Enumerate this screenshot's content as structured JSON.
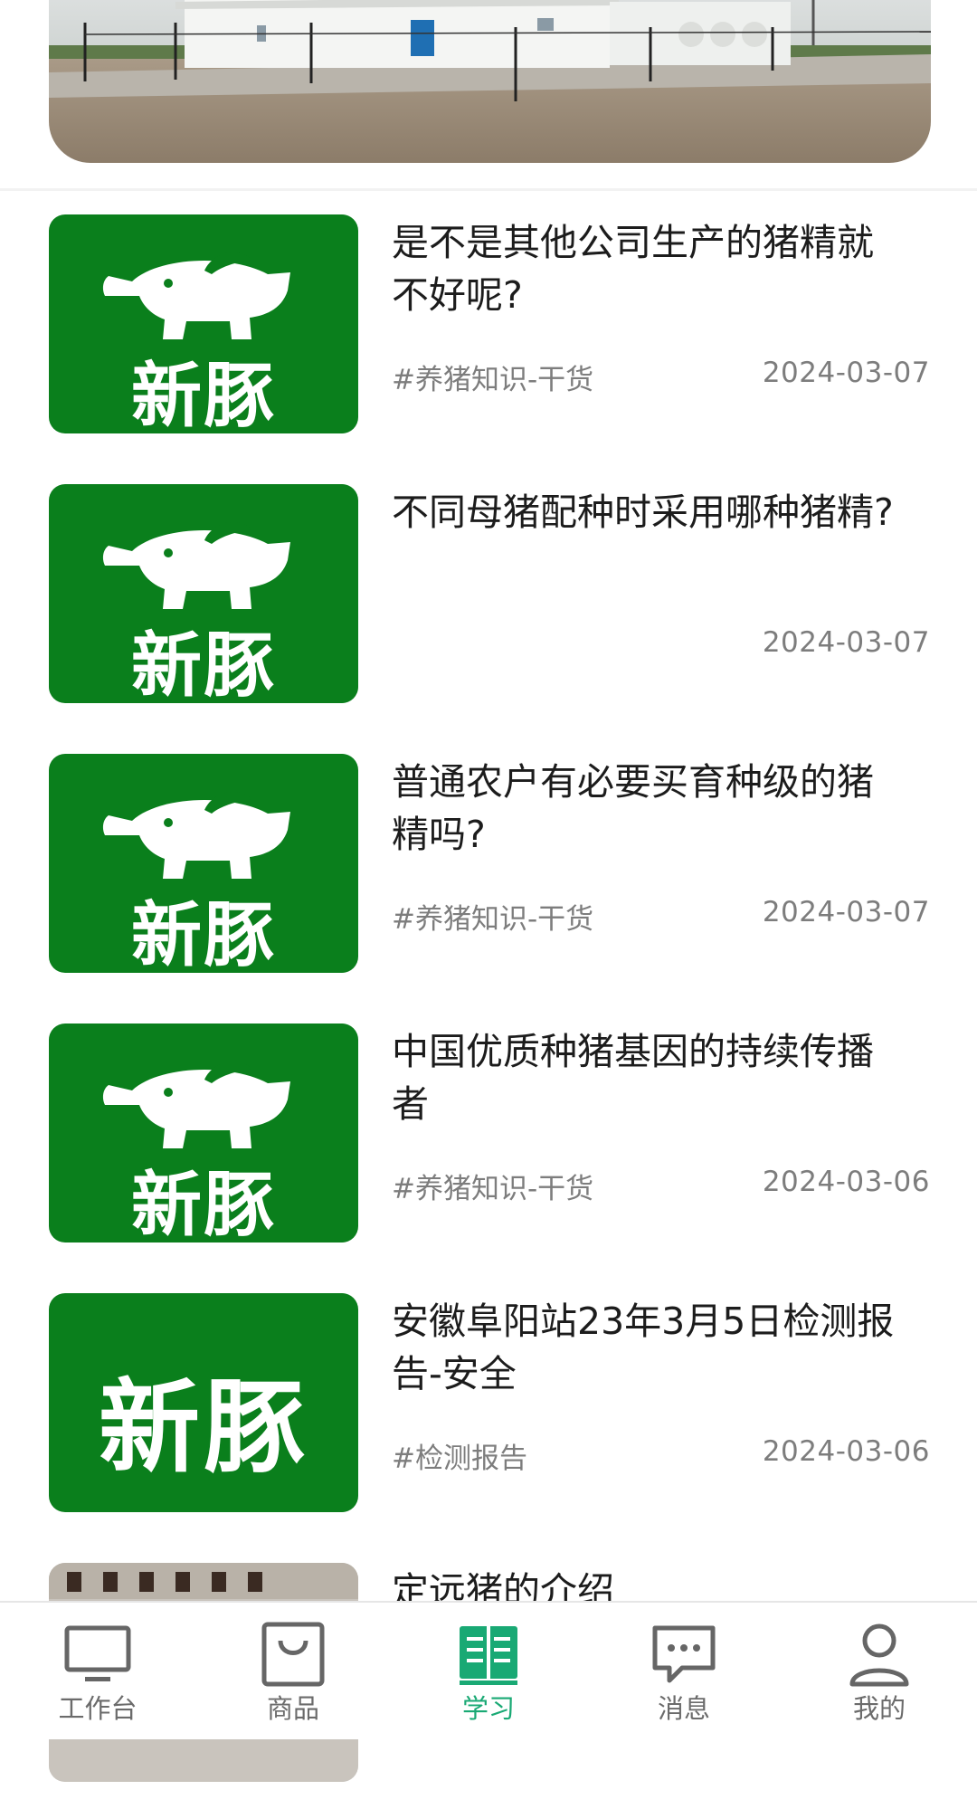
{
  "articles": [
    {
      "title": "是不是其他公司生产的猪精就不好呢?",
      "tag": "#养猪知识-干货",
      "date": "2024-03-07",
      "thumb": "logo-pig"
    },
    {
      "title": "不同母猪配种时采用哪种猪精?",
      "tag": "",
      "date": "2024-03-07",
      "thumb": "logo-pig"
    },
    {
      "title": "普通农户有必要买育种级的猪精吗?",
      "tag": "#养猪知识-干货",
      "date": "2024-03-07",
      "thumb": "logo-pig"
    },
    {
      "title": "中国优质种猪基因的持续传播者",
      "tag": "#养猪知识-干货",
      "date": "2024-03-06",
      "thumb": "logo-pig"
    },
    {
      "title": "安徽阜阳站23年3月5日检测报告-安全",
      "tag": "#检测报告",
      "date": "2024-03-06",
      "thumb": "logo-text"
    },
    {
      "title": "定远猪的介绍",
      "tag": "",
      "date": "",
      "thumb": "photo"
    }
  ],
  "brand_text": "新豚",
  "nav": [
    {
      "label": "工作台",
      "icon": "monitor-icon"
    },
    {
      "label": "商品",
      "icon": "shopping-bag-icon"
    },
    {
      "label": "学习",
      "icon": "book-icon",
      "active": true
    },
    {
      "label": "消息",
      "icon": "message-icon"
    },
    {
      "label": "我的",
      "icon": "person-icon"
    }
  ],
  "colors": {
    "brand_green": "#0a7f1c",
    "active_tab": "#19a974",
    "meta_gray": "#7d7d7d"
  }
}
